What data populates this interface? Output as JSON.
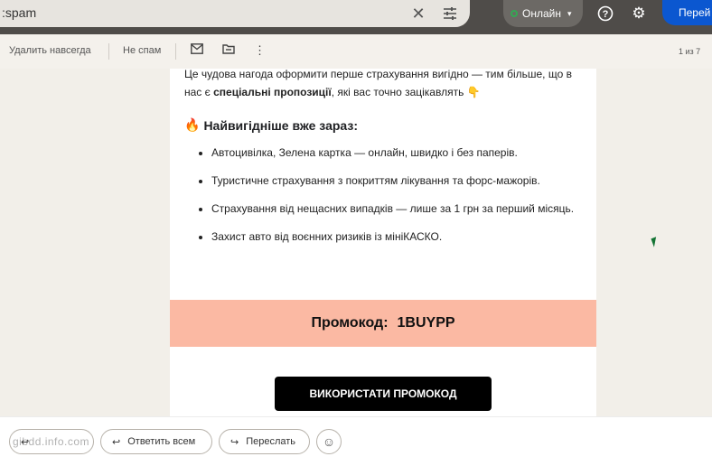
{
  "search": {
    "query": ":spam"
  },
  "header": {
    "status_label": "Онлайн",
    "signin_label": "Перей"
  },
  "toolbar": {
    "delete_forever": "Удалить навсегда",
    "not_spam": "Не спам",
    "pagination": "1 из 7"
  },
  "email": {
    "para_part1": "Це чудова нагода оформити перше страхування вигідно — тим більше, що в нас є ",
    "para_bold": "спеціальні пропозиції",
    "para_part2": ", які вас точно зацікавлять 👇",
    "section_title": "Найвигідніше вже зараз:",
    "benefits": [
      "Автоцивілка, Зелена картка — онлайн, швидко і без паперів.",
      "Туристичне страхування з покриттям лікування та форс-мажорів.",
      "Страхування від нещасних випадків — лише за 1 грн за перший місяць.",
      "Захист авто від воєнних ризиків із мініКАСКО."
    ],
    "promo_label": "Промокод:",
    "promo_code": "1BUYPP",
    "cta_label": "ВИКОРИСТАТИ ПРОМОКОД"
  },
  "actions": {
    "reply_all": "Ответить всем",
    "forward": "Переслать"
  },
  "watermark": "gibdd.info.com",
  "colors": {
    "promo_band": "#fbb9a3",
    "cta_bg": "#000000",
    "primary": "#0b57d0",
    "status_dot": "#34a853"
  },
  "icons": [
    "close-icon",
    "tune-icon",
    "help-icon",
    "gear-icon",
    "mark-unread-icon",
    "move-to-icon",
    "more-vert-icon",
    "fire-icon",
    "reply-icon",
    "reply-all-icon",
    "forward-icon",
    "emoji-icon"
  ]
}
